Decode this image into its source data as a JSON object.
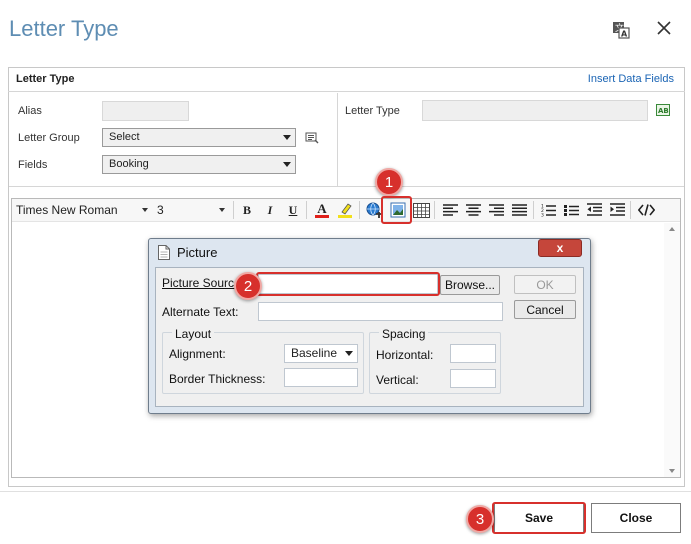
{
  "header": {
    "title": "Letter Type"
  },
  "panel": {
    "title": "Letter Type",
    "insert_link": "Insert Data Fields"
  },
  "form": {
    "alias_label": "Alias",
    "letter_group_label": "Letter Group",
    "letter_group_value": "Select",
    "fields_label": "Fields",
    "fields_value": "Booking",
    "letter_type_label": "Letter Type"
  },
  "toolbar": {
    "font_family": "Times New Roman",
    "font_size": "3",
    "bold": "B",
    "italic": "I",
    "underline": "U",
    "font_color_letter": "A"
  },
  "dialog": {
    "title": "Picture",
    "picture_source_label": "Picture Source:",
    "alternate_text_label": "Alternate Text:",
    "browse_label": "Browse...",
    "ok_label": "OK",
    "cancel_label": "Cancel",
    "layout_title": "Layout",
    "alignment_label": "Alignment:",
    "alignment_value": "Baseline",
    "border_thickness_label": "Border Thickness:",
    "spacing_title": "Spacing",
    "horizontal_label": "Horizontal:",
    "vertical_label": "Vertical:",
    "close_glyph": "x"
  },
  "markers": {
    "m1": "1",
    "m2": "2",
    "m3": "3"
  },
  "footer": {
    "save_label": "Save",
    "close_label": "Close"
  },
  "colors": {
    "accent": "#5e8db3",
    "link": "#1a64b4",
    "annotation": "#d7302c"
  }
}
